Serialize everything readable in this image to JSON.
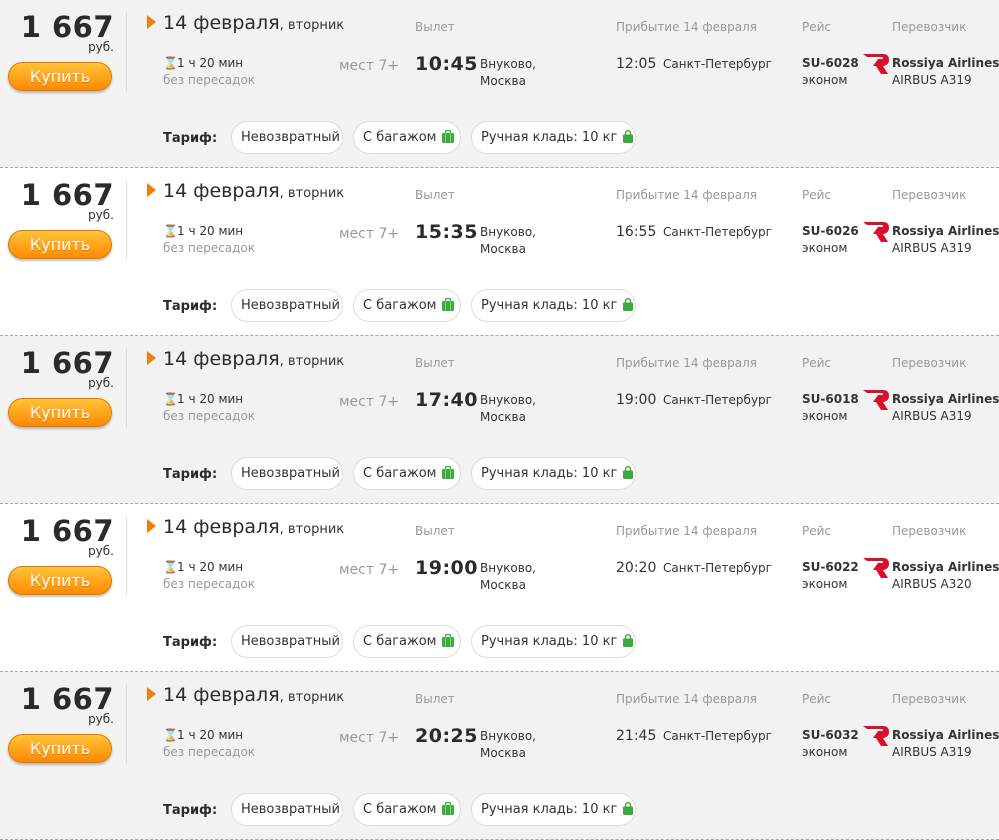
{
  "labels": {
    "currency": "руб.",
    "buy": "Купить",
    "departure": "Вылет",
    "arrival": "Прибытие 14 февраля",
    "flight": "Рейс",
    "carrier": "Перевозчик",
    "tariff": "Тариф:",
    "nonrefundable": "Невозвратный",
    "with_baggage": "С багажом",
    "hand_luggage": "Ручная кладь: 10 кг"
  },
  "colors": {
    "accent": "#f57b00",
    "buy_top": "#ffc33a",
    "buy_bottom": "#ff8a00",
    "baggage_icon": "#3aab3a",
    "airline_logo": "#d8102a"
  },
  "flights": [
    {
      "price": "1 667",
      "date": "14 февраля",
      "weekday": ", вторник",
      "duration": "1 ч 20 мин",
      "stops": "без пересадок",
      "seats": "мест 7+",
      "dep_time": "10:45",
      "dep_airport": "Внуково,",
      "dep_city": "Москва",
      "arr_time": "12:05",
      "arr_city": "Санкт-Петербург",
      "flight_no": "SU-6028",
      "class": "эконом",
      "airline": "Rossiya Airlines",
      "aircraft": "AIRBUS A319"
    },
    {
      "price": "1 667",
      "date": "14 февраля",
      "weekday": ", вторник",
      "duration": "1 ч 20 мин",
      "stops": "без пересадок",
      "seats": "мест 7+",
      "dep_time": "15:35",
      "dep_airport": "Внуково,",
      "dep_city": "Москва",
      "arr_time": "16:55",
      "arr_city": "Санкт-Петербург",
      "flight_no": "SU-6026",
      "class": "эконом",
      "airline": "Rossiya Airlines",
      "aircraft": "AIRBUS A319"
    },
    {
      "price": "1 667",
      "date": "14 февраля",
      "weekday": ", вторник",
      "duration": "1 ч 20 мин",
      "stops": "без пересадок",
      "seats": "мест 7+",
      "dep_time": "17:40",
      "dep_airport": "Внуково,",
      "dep_city": "Москва",
      "arr_time": "19:00",
      "arr_city": "Санкт-Петербург",
      "flight_no": "SU-6018",
      "class": "эконом",
      "airline": "Rossiya Airlines",
      "aircraft": "AIRBUS A319"
    },
    {
      "price": "1 667",
      "date": "14 февраля",
      "weekday": ", вторник",
      "duration": "1 ч 20 мин",
      "stops": "без пересадок",
      "seats": "мест 7+",
      "dep_time": "19:00",
      "dep_airport": "Внуково,",
      "dep_city": "Москва",
      "arr_time": "20:20",
      "arr_city": "Санкт-Петербург",
      "flight_no": "SU-6022",
      "class": "эконом",
      "airline": "Rossiya Airlines",
      "aircraft": "AIRBUS A320"
    },
    {
      "price": "1 667",
      "date": "14 февраля",
      "weekday": ", вторник",
      "duration": "1 ч 20 мин",
      "stops": "без пересадок",
      "seats": "мест 7+",
      "dep_time": "20:25",
      "dep_airport": "Внуково,",
      "dep_city": "Москва",
      "arr_time": "21:45",
      "arr_city": "Санкт-Петербург",
      "flight_no": "SU-6032",
      "class": "эконом",
      "airline": "Rossiya Airlines",
      "aircraft": "AIRBUS A319"
    }
  ]
}
